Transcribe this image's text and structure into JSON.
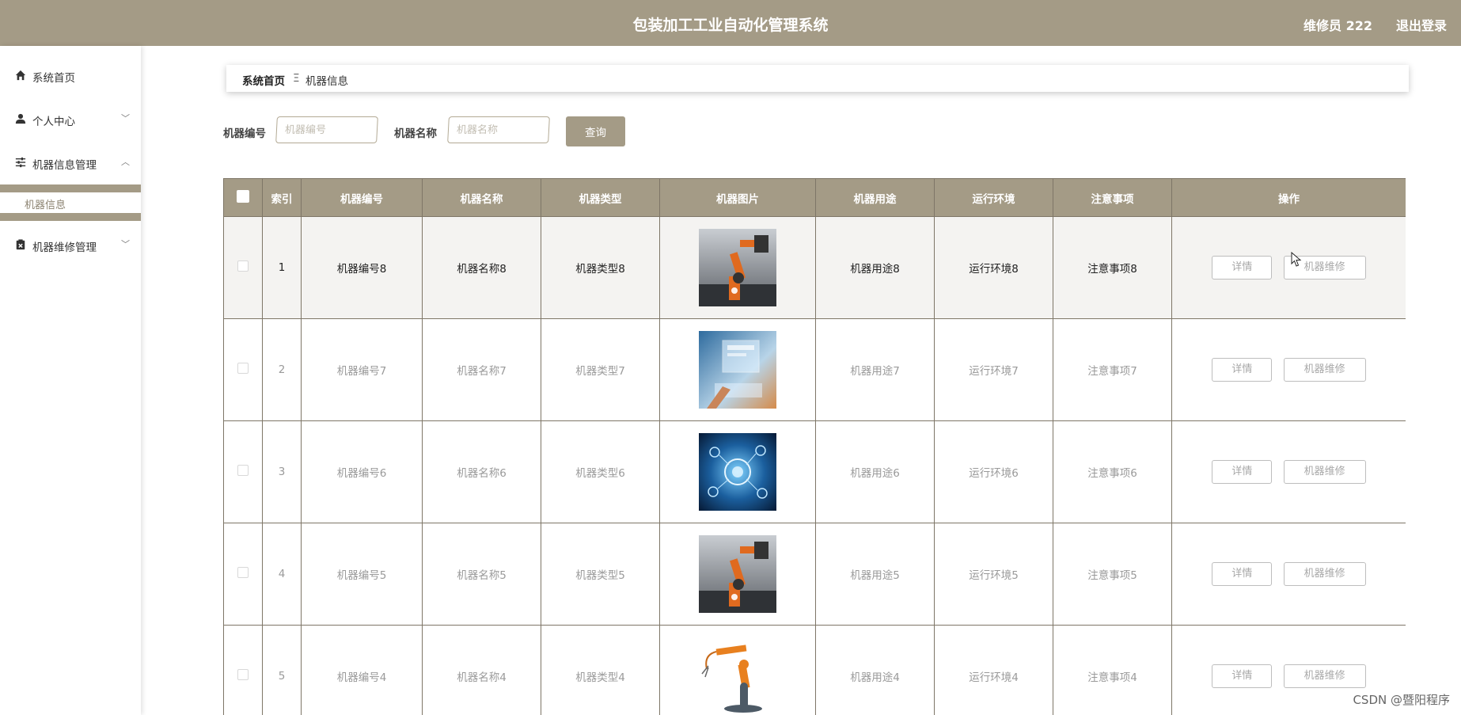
{
  "header": {
    "title": "包装加工工业自动化管理系统",
    "user": "维修员 222",
    "logout": "退出登录"
  },
  "sidebar": {
    "items": [
      {
        "label": "系统首页",
        "icon": "home-icon"
      },
      {
        "label": "个人中心",
        "icon": "user-icon",
        "chevron": "﹀"
      },
      {
        "label": "机器信息管理",
        "icon": "sliders-icon",
        "chevron": "︿"
      },
      {
        "label": "机器维修管理",
        "icon": "clipboard-x-icon",
        "chevron": "﹀"
      }
    ],
    "subitems": [
      {
        "label": "机器信息"
      }
    ]
  },
  "breadcrumb": {
    "home": "系统首页",
    "separator": "Ξ",
    "current": "机器信息"
  },
  "search": {
    "id_label": "机器编号",
    "id_placeholder": "机器编号",
    "id_value": "",
    "name_label": "机器名称",
    "name_placeholder": "机器名称",
    "name_value": "",
    "query_button": "查询"
  },
  "table": {
    "headers": [
      "索引",
      "机器编号",
      "机器名称",
      "机器类型",
      "机器图片",
      "机器用途",
      "运行环境",
      "注意事项",
      "操作"
    ],
    "rows": [
      {
        "index": "1",
        "id": "机器编号8",
        "name": "机器名称8",
        "type": "机器类型8",
        "image": "robot-arm-orange",
        "usage": "机器用途8",
        "env": "运行环境8",
        "notes": "注意事项8"
      },
      {
        "index": "2",
        "id": "机器编号7",
        "name": "机器名称7",
        "type": "机器类型7",
        "image": "holographic-screen",
        "usage": "机器用途7",
        "env": "运行环境7",
        "notes": "注意事项7"
      },
      {
        "index": "3",
        "id": "机器编号6",
        "name": "机器名称6",
        "type": "机器类型6",
        "image": "blue-network-icons",
        "usage": "机器用途6",
        "env": "运行环境6",
        "notes": "注意事项6"
      },
      {
        "index": "4",
        "id": "机器编号5",
        "name": "机器名称5",
        "type": "机器类型5",
        "image": "robot-arm-orange",
        "usage": "机器用途5",
        "env": "运行环境5",
        "notes": "注意事项5"
      },
      {
        "index": "5",
        "id": "机器编号4",
        "name": "机器名称4",
        "type": "机器类型4",
        "image": "robot-arm-white-bg",
        "usage": "机器用途4",
        "env": "运行环境4",
        "notes": "注意事项4"
      }
    ],
    "actions": {
      "detail": "详情",
      "repair": "机器维修"
    }
  },
  "watermark": "CSDN @暨阳程序",
  "colors": {
    "brand": "#a49b86",
    "border": "#7e7667",
    "row_highlight": "#f4f3f1"
  }
}
